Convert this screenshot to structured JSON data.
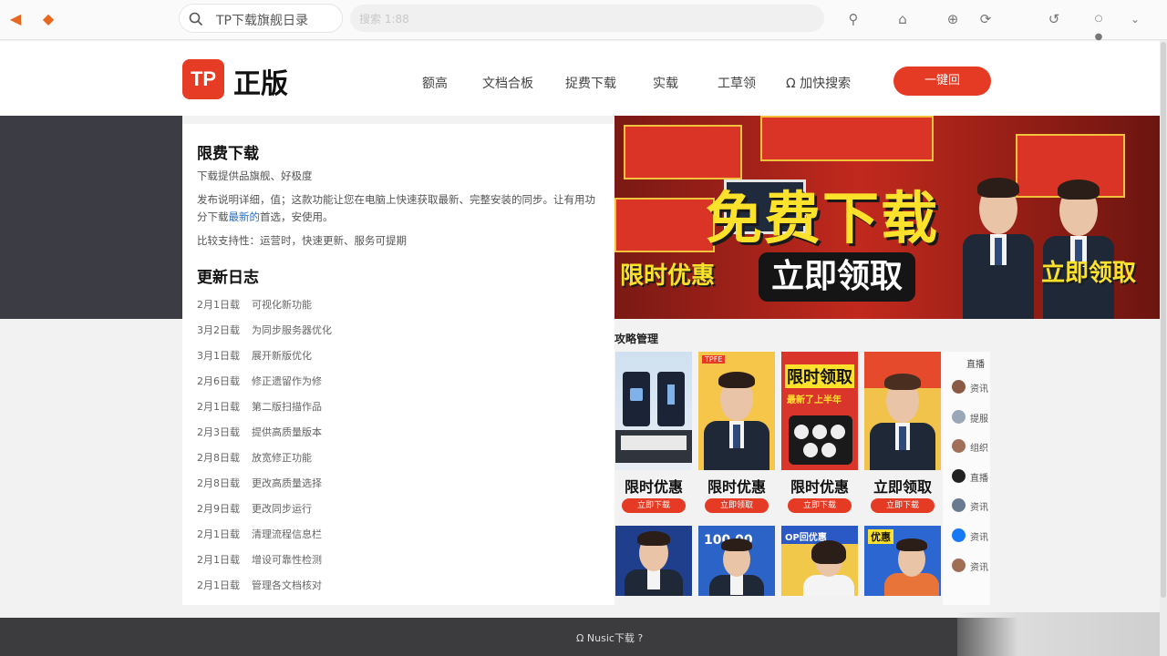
{
  "browser": {
    "search_placeholder": "TP下载旗舰日录",
    "address": "搜索 1:88",
    "toolbar_icons": [
      "search-icon",
      "extension-icon",
      "plus-circle-icon",
      "share-icon",
      "history-icon",
      "menu-dots-icon",
      "chevron-down-icon"
    ]
  },
  "site": {
    "logo_mark": "TP",
    "logo_text": "正版",
    "nav": [
      "额高",
      "文档合板",
      "捉费下载",
      "实载",
      "工草领",
      "Ω 加快搜索"
    ],
    "login_label": "一键回"
  },
  "hero": {
    "main_text": "免费下载",
    "sub_text": "立即领取",
    "left_text": "限时优惠",
    "right_text": "立即领取"
  },
  "panel": {
    "title_download": "限费下载",
    "desc1": "下载提供品旗舰、好极度",
    "desc2_a": "发布说明详细，值；这款功能让您在电脑上快速获取最新、完整安装的同步。让有用功分下载",
    "desc2_link": "最新的",
    "desc2_b": "首选，安使用。",
    "desc3": "比较支持性：运营时，快速更新、服务可提期",
    "title_changelog": "更新日志",
    "changelog": [
      {
        "date": "2月1日载",
        "text": "可视化新功能"
      },
      {
        "date": "3月2日载",
        "text": "为同步服务器优化"
      },
      {
        "date": "3月1日载",
        "text": "展开新版优化"
      },
      {
        "date": "2月6日载",
        "text": "修正遗留作为修"
      },
      {
        "date": "2月1日载",
        "text": "第二版扫描作品"
      },
      {
        "date": "2月3日载",
        "text": "提供高质量版本"
      },
      {
        "date": "2月8日载",
        "text": "放宽修正功能"
      },
      {
        "date": "2月8日载",
        "text": "更改高质量选择"
      },
      {
        "date": "2月9日载",
        "text": "更改同步运行"
      },
      {
        "date": "2月1日载",
        "text": "清理流程信息栏"
      },
      {
        "date": "2月1日载",
        "text": "增设可靠性检测"
      },
      {
        "date": "2月1日载",
        "text": "管理各文档核对"
      }
    ]
  },
  "guides": {
    "title": "攻略管理",
    "cards": [
      {
        "label": "限时优惠",
        "button": "立即下载"
      },
      {
        "label": "限时优惠",
        "button": "立即领取"
      },
      {
        "label": "限时优惠",
        "button": "立即下载"
      },
      {
        "label": "立即领取",
        "button": "立即下载"
      }
    ],
    "card1_tag": "TPFE",
    "card3_title": "限时领取",
    "card3_sub": "最新了上半年",
    "row2_tags": [
      "",
      "100 00",
      "OP回优惠",
      "优惠"
    ]
  },
  "side": {
    "title": "直播",
    "items": [
      "资讯",
      "提服",
      "组织",
      "直播",
      "资讯",
      "资讯",
      "资讯"
    ],
    "colors": [
      "#8a5a44",
      "#9aa7b8",
      "#a0705a",
      "#222222",
      "#6a7a90",
      "#1877f2",
      "#a06d55"
    ]
  },
  "footer": {
    "text": "Ω Nusic下载 ?"
  }
}
